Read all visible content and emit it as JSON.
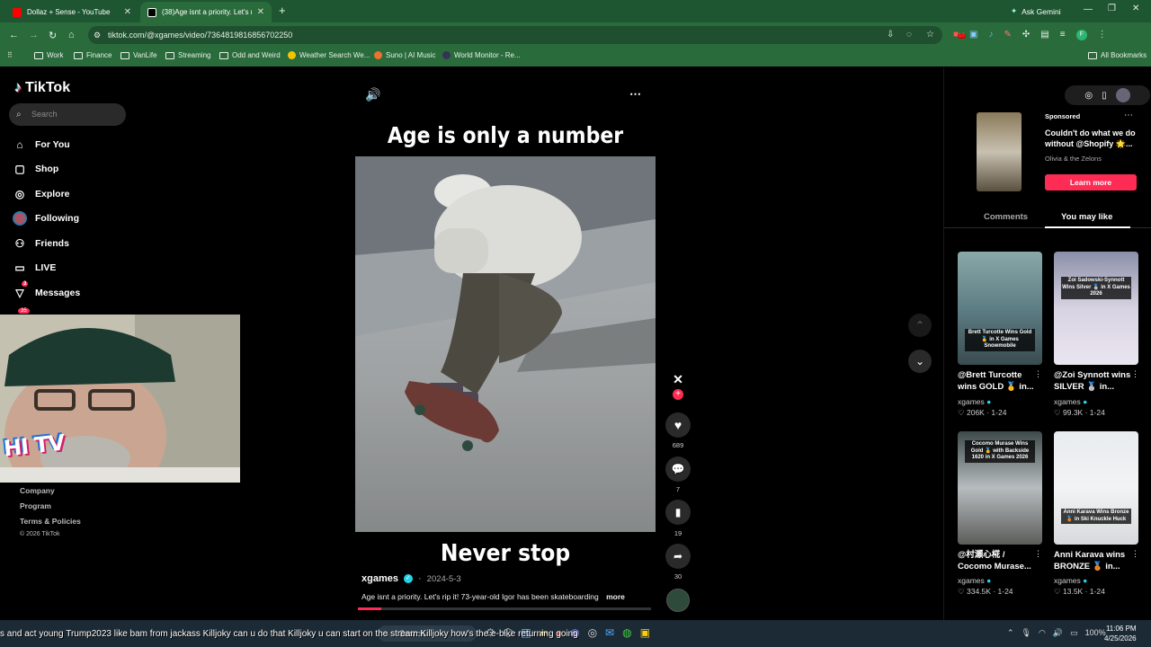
{
  "browser": {
    "tabs": [
      {
        "title": "Dollaz + Sense - YouTube",
        "active": false
      },
      {
        "title": "(38)Age isnt a priority. Let's rip",
        "active": true
      }
    ],
    "ask_gemini": "Ask Gemini",
    "url": "tiktok.com/@xgames/video/7364819816856702250",
    "bookmarks": [
      "Work",
      "Finance",
      "VanLife",
      "Streaming",
      "Odd and Weird",
      "Weather Search We...",
      "Suno | AI Music",
      "World Monitor - Re..."
    ],
    "all_bookmarks": "All Bookmarks",
    "ext_badge": "10"
  },
  "tiktok": {
    "logo": "TikTok",
    "search_placeholder": "Search",
    "nav": [
      {
        "label": "For You",
        "icon": "home-icon"
      },
      {
        "label": "Shop",
        "icon": "shop-icon"
      },
      {
        "label": "Explore",
        "icon": "compass-icon"
      },
      {
        "label": "Following",
        "icon": "avatar-icon"
      },
      {
        "label": "Friends",
        "icon": "friends-icon"
      },
      {
        "label": "LIVE",
        "icon": "live-icon"
      },
      {
        "label": "Messages",
        "icon": "send-icon",
        "badge": "3"
      }
    ],
    "activity_badge": "35",
    "footer_links": [
      "Company",
      "Program",
      "Terms & Policies",
      "© 2026 TikTok"
    ],
    "video": {
      "title": "Age is only a number",
      "caption": "Never stop",
      "author": "xgames",
      "date": "2024-5-3",
      "description": "Age isnt a priority.  Let's rip it! 73-year-old Igor has been skateboarding",
      "more": "more",
      "likes": "689",
      "comments": "7",
      "saves": "19",
      "shares": "30"
    },
    "sponsored": {
      "label": "Sponsored",
      "title": "Couldn't do what we do without @Shopify 🌟...",
      "author": "Olivia & the Zelons",
      "cta": "Learn more"
    },
    "tabs": [
      "Comments",
      "You may like"
    ],
    "active_tab": "You may like",
    "cards": [
      {
        "overlay": "Brett Turcotte Wins Gold 🥇 in X Games Snowmobile",
        "title": "@Brett Turcotte wins GOLD 🥇 in...",
        "author": "xgames",
        "likes": "206K",
        "date": "1-24"
      },
      {
        "overlay": "Zoi Sadowski-Synnott Wins Silver 🥈 in X Games 2026",
        "title": "@Zoi Synnott wins SILVER 🥈 in...",
        "author": "xgames",
        "likes": "99.3K",
        "date": "1-24"
      },
      {
        "overlay": "Cocomo Murase Wins Gold 🥇 with Backside 1620 in X Games 2026",
        "title": "@村瀬心椛 / Cocomo Murase...",
        "author": "xgames",
        "likes": "334.5K",
        "date": "1-24"
      },
      {
        "overlay": "Anni Karava Wins Bronze 🥉 in Ski Knuckle Huck",
        "title": "Anni Karava wins BRONZE 🥉 in...",
        "author": "xgames",
        "likes": "13.5K",
        "date": "1-24"
      }
    ]
  },
  "overlay": {
    "ticker": "s and act young   Trump2023 like bam from jackass   Killjoky can u do that   Killjoky u can start on the stream   Killjoky how's the e-bike returning going",
    "webcam_logo": "HI TV"
  },
  "taskbar": {
    "search": "Search",
    "battery": "100%",
    "time": "11:06 PM",
    "date": "4/25/2026"
  },
  "colors": {
    "tiktok_red": "#fe2c55",
    "chrome_green": "#1e5631",
    "verified": "#20d5ec"
  }
}
